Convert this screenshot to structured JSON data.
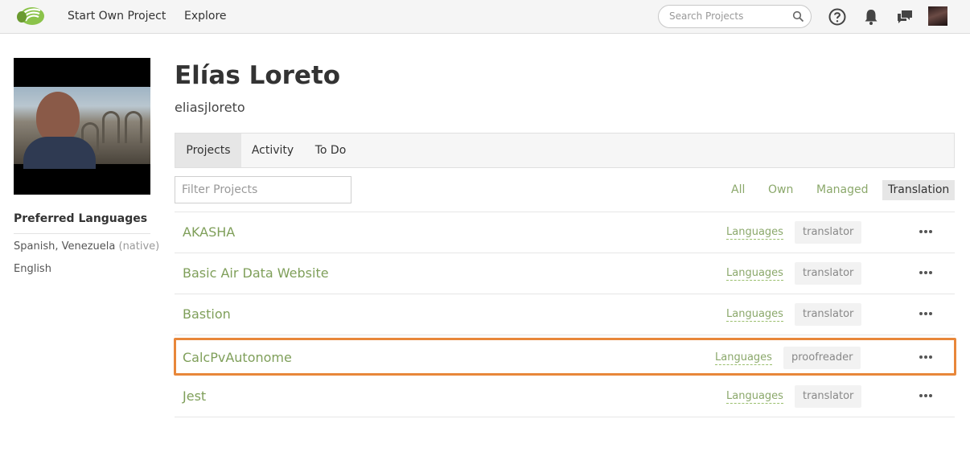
{
  "topbar": {
    "nav": [
      "Start Own Project",
      "Explore"
    ],
    "search_placeholder": "Search Projects",
    "icons": [
      "app-logo",
      "search-icon",
      "help-icon",
      "bell-icon",
      "chat-icon",
      "user-avatar"
    ],
    "brand_color": "#7cb342"
  },
  "profile": {
    "name": "Elías Loreto",
    "username": "eliasjloreto",
    "preferred_languages_title": "Preferred Languages",
    "languages": [
      {
        "name": "Spanish, Venezuela",
        "note": "(native)"
      },
      {
        "name": "English",
        "note": ""
      }
    ]
  },
  "tabs": [
    "Projects",
    "Activity",
    "To Do"
  ],
  "active_tab": "Projects",
  "filter": {
    "placeholder": "Filter Projects",
    "options": [
      "All",
      "Own",
      "Managed",
      "Translation"
    ],
    "selected": "Translation"
  },
  "projects": [
    {
      "name": "AKASHA",
      "languages_label": "Languages",
      "role": "translator"
    },
    {
      "name": "Basic Air Data Website",
      "languages_label": "Languages",
      "role": "translator"
    },
    {
      "name": "Bastion",
      "languages_label": "Languages",
      "role": "translator"
    },
    {
      "name": "CalcPvAutonome",
      "languages_label": "Languages",
      "role": "proofreader",
      "highlighted": true
    },
    {
      "name": "Jest",
      "languages_label": "Languages",
      "role": "translator"
    }
  ],
  "colors": {
    "link_green": "#7f9f5a",
    "highlight_orange": "#e8873a"
  }
}
